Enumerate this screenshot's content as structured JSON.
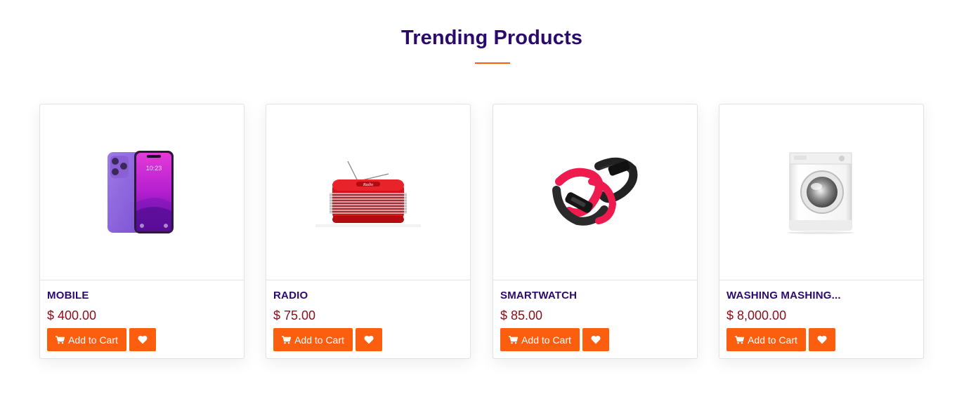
{
  "section": {
    "title": "Trending Products",
    "accent_color": "#fc5e0f",
    "title_color": "#2a0a6a"
  },
  "products": [
    {
      "name": "MOBILE",
      "price": "$ 400.00",
      "image_icon": "smartphone-image",
      "add_to_cart_label": "Add to Cart",
      "wishlist_icon": "heart-icon"
    },
    {
      "name": "RADIO",
      "price": "$ 75.00",
      "image_icon": "radio-image",
      "add_to_cart_label": "Add to Cart",
      "wishlist_icon": "heart-icon"
    },
    {
      "name": "SMARTWATCH",
      "price": "$ 85.00",
      "image_icon": "smartwatch-image",
      "add_to_cart_label": "Add to Cart",
      "wishlist_icon": "heart-icon"
    },
    {
      "name": "WASHING MASHING...",
      "price": "$ 8,000.00",
      "image_icon": "washing-machine-image",
      "add_to_cart_label": "Add to Cart",
      "wishlist_icon": "heart-icon"
    }
  ],
  "price_color": "#8b0d18"
}
